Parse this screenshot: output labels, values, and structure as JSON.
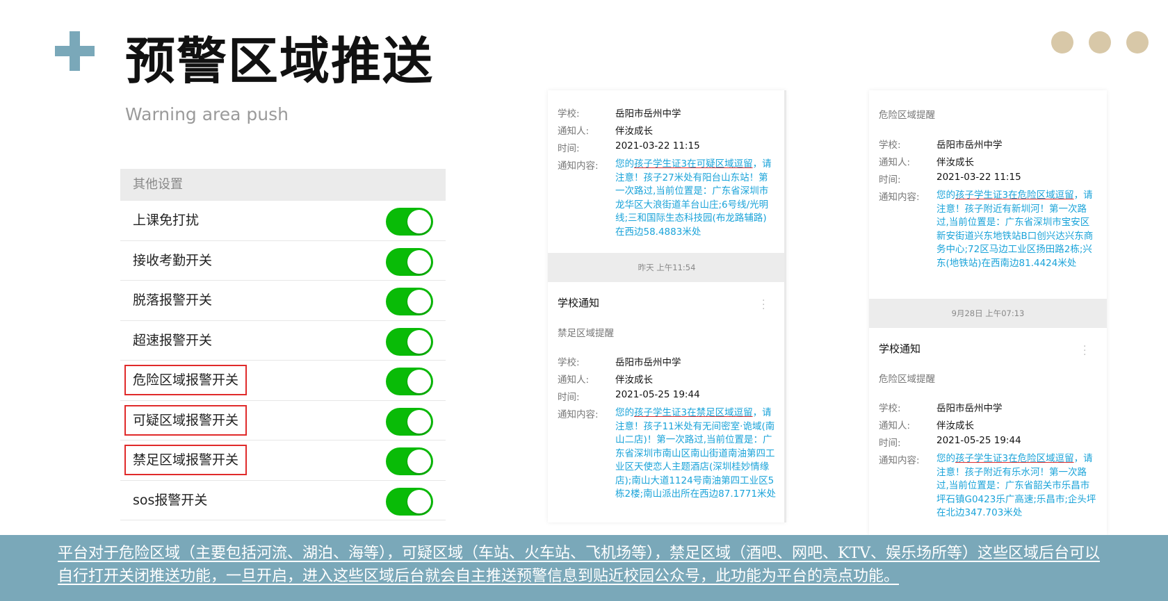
{
  "title": "预警区域推送",
  "subtitle": "Warning area push",
  "settings": {
    "header": "其他设置",
    "items": [
      {
        "label": "上课免打扰",
        "on": true
      },
      {
        "label": "接收考勤开关",
        "on": true
      },
      {
        "label": "脱落报警开关",
        "on": true
      },
      {
        "label": "超速报警开关",
        "on": true
      },
      {
        "label": "危险区域报警开关",
        "on": true
      },
      {
        "label": "可疑区域报警开关",
        "on": true
      },
      {
        "label": "禁足区域报警开关",
        "on": true
      },
      {
        "label": "sos报警开关",
        "on": true
      }
    ]
  },
  "labels": {
    "school": "学校:",
    "notifier": "通知人:",
    "time": "时间:",
    "content": "通知内容:"
  },
  "col1": {
    "msg1": {
      "school": "岳阳市岳州中学",
      "notifier": "伴汝成长",
      "time": "2021-03-22 11:15",
      "content_prefix": "您的",
      "content_highlight": "孩子学生证3在可疑区域逗留",
      "content_rest": "，请注意！孩子27米处有阳台山东站！第一次路过,当前位置是：广东省深圳市龙华区大浪街道羊台山庄;6号线/光明线;三和国际生态科技园(布龙路辅路)在西边58.4883米处"
    },
    "time_bar": "昨天 上午11:54",
    "card_title": "学校通知",
    "card_sub": "禁足区域提醒",
    "msg2": {
      "school": "岳阳市岳州中学",
      "notifier": "伴汝成长",
      "time": "2021-05-25 19:44",
      "content_prefix": "您的",
      "content_highlight": "孩子学生证3在禁足区域逗留",
      "content_rest": "，请注意！孩子11米处有无间密室·诡域(南山二店)！第一次路过,当前位置是：广东省深圳市南山区南山街道南油第四工业区天使恋人主题酒店(深圳桂妙情缘店);南山大道1124号南油第四工业区5栋2楼;南山派出所在西边87.1771米处"
    }
  },
  "col2": {
    "top_sub": "危险区域提醒",
    "msg1": {
      "school": "岳阳市岳州中学",
      "notifier": "伴汝成长",
      "time": "2021-03-22 11:15",
      "content_prefix": "您的",
      "content_highlight": "孩子学生证3在危险区域逗留",
      "content_rest": "，请注意！孩子附近有新圳河！第一次路过,当前位置是：广东省深圳市宝安区新安街道兴东地铁站B口创兴达兴东商务中心;72区马边工业区扬田路2栋;兴东(地铁站)在西南边81.4424米处"
    },
    "time_bar": "9月28日 上午07:13",
    "card_title": "学校通知",
    "card_sub": "危险区域提醒",
    "msg2": {
      "school": "岳阳市岳州中学",
      "notifier": "伴汝成长",
      "time": "2021-05-25 19:44",
      "content_prefix": "您的",
      "content_highlight": "孩子学生证3在危险区域逗留",
      "content_rest": "，请注意！孩子附近有乐水河！第一次路过,当前位置是：广东省韶关市乐昌市坪石镇G0423乐广高速;乐昌市;企头坪在北边347.703米处"
    }
  },
  "banner": "平台对于危险区域（主要包括河流、湖泊、海等），可疑区域（车站、火车站、飞机场等），禁足区域（酒吧、网吧、KTV、娱乐场所等）这些区域后台可以自行打开关闭推送功能，一旦开启，进入这些区域后台就会自主推送预警信息到贴近校园公众号，此功能为平台的亮点功能。"
}
